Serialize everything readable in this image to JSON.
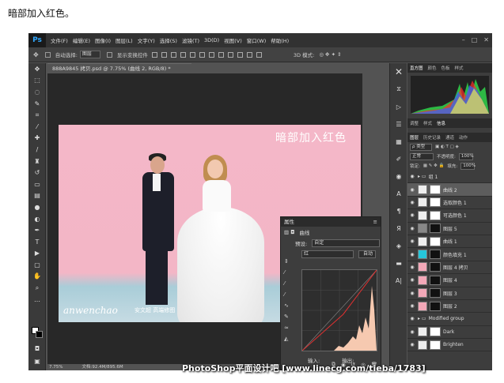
{
  "caption": "暗部加入红色。",
  "app": {
    "logo": "Ps"
  },
  "menu": [
    "文件(F)",
    "编辑(E)",
    "图像(I)",
    "图层(L)",
    "文字(Y)",
    "选择(S)",
    "滤镜(T)",
    "3D(D)",
    "视图(V)",
    "窗口(W)",
    "帮助(H)"
  ],
  "options_bar": {
    "auto_select": "自动选择:",
    "auto_select_value": "图层",
    "show_transform": "显示变换控件",
    "mode3d": "3D 模式:"
  },
  "document_tab": "888A9845 拷贝.psd @ 7.75% (曲线 2, RGB/8) *",
  "photo": {
    "overlay_text": "暗部加入红色",
    "signature": "anwenchao",
    "signature_cn": "安文超 高端修图"
  },
  "status": {
    "zoom": "7.75%",
    "doc": "文档:92.4M/895.6M"
  },
  "watermark": "PhotoShop平面设计吧 [www.linecg.com/tieba/1783]",
  "properties": {
    "title": "属性",
    "adj_name": "曲线",
    "preset_label": "预设:",
    "preset_value": "自定",
    "channel_value": "红",
    "auto_btn": "自动",
    "input_label": "输入:",
    "output_label": "输出:",
    "curve_points": [
      [
        0,
        0
      ],
      [
        0.55,
        0.45
      ],
      [
        1,
        1
      ]
    ],
    "histogram_color": "#f6c9b0"
  },
  "right_panel": {
    "top_tabs": [
      "直方图",
      "颜色",
      "色板",
      "样式"
    ],
    "mid_tabs": [
      "调整",
      "样式",
      "信息"
    ],
    "layer_tabs": [
      "图层",
      "历史记录",
      "通道",
      "动作"
    ],
    "kind_value": "ρ 类型",
    "blend_value": "正常",
    "opacity_label": "不透明度:",
    "opacity_value": "100%",
    "lock_label": "锁定:",
    "fill_label": "填充:",
    "fill_value": "100%",
    "layers": [
      {
        "name": "组 1",
        "type": "group",
        "selected": false
      },
      {
        "name": "曲线 2",
        "type": "adj",
        "selected": true
      },
      {
        "name": "选取颜色 1",
        "type": "adj",
        "selected": false
      },
      {
        "name": "可选颜色 1",
        "type": "adj",
        "selected": false
      },
      {
        "name": "图层 5",
        "type": "pixel",
        "selected": false
      },
      {
        "name": "曲线 1",
        "type": "adj",
        "selected": false
      },
      {
        "name": "颜色填充 1",
        "type": "fill",
        "selected": false
      },
      {
        "name": "图层 4 拷贝",
        "type": "pixel",
        "selected": false
      },
      {
        "name": "图层 4",
        "type": "pixel",
        "selected": false
      },
      {
        "name": "图层 3",
        "type": "pixel",
        "selected": false
      },
      {
        "name": "图层 2",
        "type": "pixel",
        "selected": false
      },
      {
        "name": "Modified group",
        "type": "group",
        "selected": false
      },
      {
        "name": "Dark",
        "type": "adj",
        "selected": false
      },
      {
        "name": "Brighten",
        "type": "adj",
        "selected": false
      }
    ]
  }
}
